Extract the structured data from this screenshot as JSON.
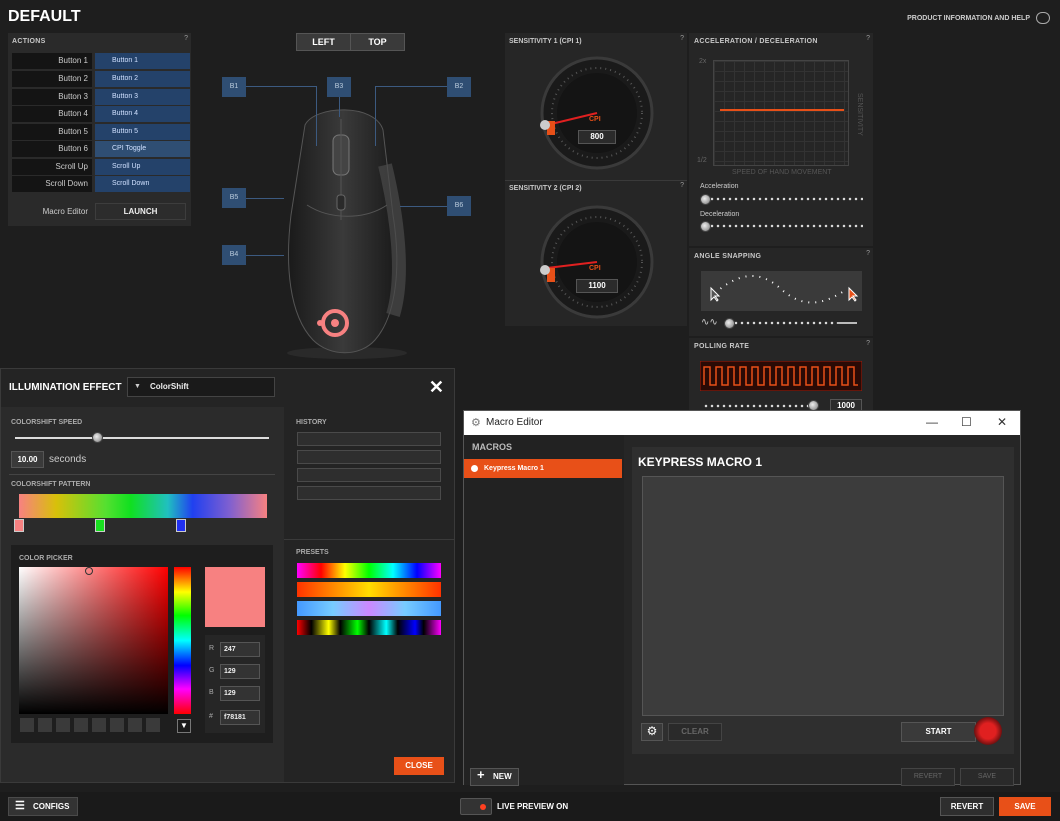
{
  "header": {
    "title": "DEFAULT",
    "help": "PRODUCT INFORMATION AND HELP"
  },
  "actions": {
    "title": "ACTIONS",
    "rows": [
      {
        "label": "Button 1",
        "value": "Button 1"
      },
      {
        "label": "Button 2",
        "value": "Button 2"
      },
      {
        "label": "Button 3",
        "value": "Button 3"
      },
      {
        "label": "Button 4",
        "value": "Button 4"
      },
      {
        "label": "Button 5",
        "value": "Button 5"
      },
      {
        "label": "Button 6",
        "value": "CPI Toggle"
      },
      {
        "label": "Scroll Up",
        "value": "Scroll Up"
      },
      {
        "label": "Scroll Down",
        "value": "Scroll Down"
      }
    ],
    "macro_label": "Macro Editor",
    "launch": "LAUNCH"
  },
  "view": {
    "left": "LEFT",
    "top": "TOP"
  },
  "buttons_map": {
    "b1": "B1",
    "b2": "B2",
    "b3": "B3",
    "b4": "B4",
    "b5": "B5",
    "b6": "B6"
  },
  "sensitivity": {
    "s1_title": "SENSITIVITY 1 (CPI 1)",
    "s1_value": "800",
    "s2_title": "SENSITIVITY 2 (CPI 2)",
    "s2_value": "1100",
    "cpi": "CPI"
  },
  "accel": {
    "title": "ACCELERATION / DECELERATION",
    "y_top": "2x",
    "y_bottom": "1/2",
    "xlabel": "SPEED OF HAND MOVEMENT",
    "ylabel": "SENSITIVITY",
    "acceleration": "Acceleration",
    "deceleration": "Deceleration"
  },
  "angle": {
    "title": "ANGLE SNAPPING"
  },
  "polling": {
    "title": "POLLING RATE",
    "value": "1000"
  },
  "illumination": {
    "title": "ILLUMINATION EFFECT",
    "effect": "ColorShift",
    "speed_label": "COLORSHIFT SPEED",
    "speed_value": "10.00",
    "speed_unit": "seconds",
    "pattern_label": "COLORSHIFT PATTERN",
    "picker_label": "COLOR PICKER",
    "history_label": "HISTORY",
    "presets_label": "PRESETS",
    "r_label": "R",
    "g_label": "G",
    "b_label": "B",
    "hex_label": "#",
    "r": "247",
    "g": "129",
    "b": "129",
    "hex": "f78181",
    "close": "CLOSE",
    "selected_color": "#f78181"
  },
  "macro_editor": {
    "window_title": "Macro Editor",
    "macros_label": "MACROS",
    "items": [
      "Keypress Macro 1"
    ],
    "new": "NEW",
    "name": "KEYPRESS MACRO 1",
    "clear": "CLEAR",
    "start": "START",
    "revert": "REVERT",
    "save": "SAVE"
  },
  "footer": {
    "configs": "CONFIGS",
    "live_preview": "LIVE PREVIEW ON",
    "revert": "REVERT",
    "save": "SAVE"
  },
  "colors": {
    "accent": "#e85018",
    "button_bg": "#2f4e73"
  }
}
